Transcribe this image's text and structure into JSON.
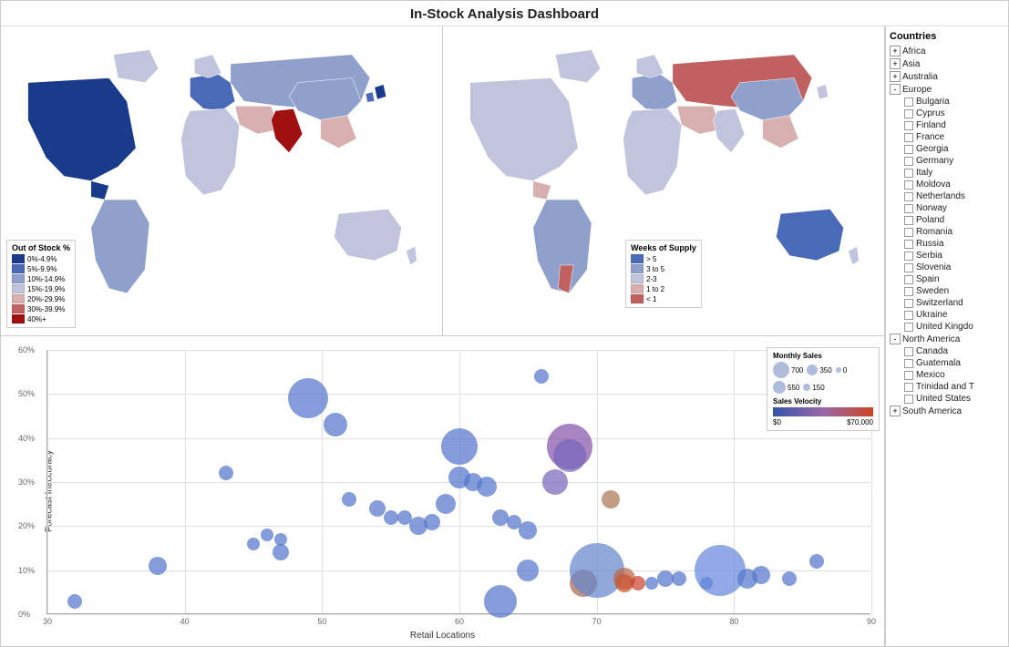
{
  "title": "In-Stock Analysis Dashboard",
  "maps": {
    "left_legend_title": "Out of Stock %",
    "left_legend_items": [
      {
        "label": "0%-4.9%",
        "color": "#1a3a8c"
      },
      {
        "label": "5%-9.9%",
        "color": "#4a6ab8"
      },
      {
        "label": "10%-14.9%",
        "color": "#8fa0cc"
      },
      {
        "label": "15%-19.9%",
        "color": "#c0c4dd"
      },
      {
        "label": "20%-29.9%",
        "color": "#d9b0b0"
      },
      {
        "label": "30%-39.9%",
        "color": "#c06060"
      },
      {
        "label": "40%+",
        "color": "#a01010"
      }
    ],
    "right_legend_title": "Weeks of Supply",
    "right_legend_items": [
      {
        "label": "> 5",
        "color": "#4a6ab8"
      },
      {
        "label": "3 to 5",
        "color": "#8fa0cc"
      },
      {
        "label": "2-3",
        "color": "#c0c4dd"
      },
      {
        "label": "1 to 2",
        "color": "#d9b0b0"
      },
      {
        "label": "< 1",
        "color": "#c06060"
      }
    ]
  },
  "scatter": {
    "title_y": "Forecast Inaccuracy",
    "title_x": "Retail Locations",
    "y_labels": [
      "0%",
      "10%",
      "20%",
      "30%",
      "40%",
      "50%",
      "60%"
    ],
    "x_labels": [
      "30",
      "40",
      "50",
      "60",
      "70",
      "80",
      "90"
    ],
    "legend_title_size": "Monthly Sales",
    "legend_sizes": [
      "700",
      "350",
      "0",
      "550",
      "150"
    ],
    "legend_gradient_title": "Sales Velocity",
    "legend_gradient_min": "$0",
    "legend_gradient_max": "$70,000",
    "bubbles": [
      {
        "x": 32,
        "y": 3,
        "r": 8,
        "color": "#5577cc"
      },
      {
        "x": 38,
        "y": 11,
        "r": 10,
        "color": "#5577cc"
      },
      {
        "x": 43,
        "y": 32,
        "r": 8,
        "color": "#5577cc"
      },
      {
        "x": 45,
        "y": 16,
        "r": 7,
        "color": "#5577cc"
      },
      {
        "x": 46,
        "y": 18,
        "r": 7,
        "color": "#5577cc"
      },
      {
        "x": 47,
        "y": 14,
        "r": 9,
        "color": "#5577cc"
      },
      {
        "x": 47,
        "y": 17,
        "r": 7,
        "color": "#5577cc"
      },
      {
        "x": 49,
        "y": 49,
        "r": 22,
        "color": "#5577cc"
      },
      {
        "x": 51,
        "y": 43,
        "r": 13,
        "color": "#5577cc"
      },
      {
        "x": 52,
        "y": 26,
        "r": 8,
        "color": "#5577cc"
      },
      {
        "x": 54,
        "y": 24,
        "r": 9,
        "color": "#5577cc"
      },
      {
        "x": 55,
        "y": 22,
        "r": 8,
        "color": "#5577cc"
      },
      {
        "x": 56,
        "y": 22,
        "r": 8,
        "color": "#5577cc"
      },
      {
        "x": 57,
        "y": 20,
        "r": 10,
        "color": "#5577cc"
      },
      {
        "x": 58,
        "y": 21,
        "r": 9,
        "color": "#5577cc"
      },
      {
        "x": 59,
        "y": 25,
        "r": 11,
        "color": "#5577cc"
      },
      {
        "x": 60,
        "y": 38,
        "r": 20,
        "color": "#5577cc"
      },
      {
        "x": 60,
        "y": 31,
        "r": 12,
        "color": "#5577cc"
      },
      {
        "x": 61,
        "y": 30,
        "r": 10,
        "color": "#5577cc"
      },
      {
        "x": 62,
        "y": 29,
        "r": 11,
        "color": "#5577cc"
      },
      {
        "x": 63,
        "y": 22,
        "r": 9,
        "color": "#5577cc"
      },
      {
        "x": 63,
        "y": 3,
        "r": 18,
        "color": "#5577cc"
      },
      {
        "x": 64,
        "y": 21,
        "r": 8,
        "color": "#5577cc"
      },
      {
        "x": 65,
        "y": 19,
        "r": 10,
        "color": "#5577cc"
      },
      {
        "x": 65,
        "y": 10,
        "r": 12,
        "color": "#5577cc"
      },
      {
        "x": 66,
        "y": 54,
        "r": 8,
        "color": "#5577cc"
      },
      {
        "x": 67,
        "y": 30,
        "r": 14,
        "color": "#7766bb"
      },
      {
        "x": 68,
        "y": 38,
        "r": 25,
        "color": "#8855aa"
      },
      {
        "x": 68,
        "y": 36,
        "r": 18,
        "color": "#7766bb"
      },
      {
        "x": 69,
        "y": 7,
        "r": 15,
        "color": "#aa6655"
      },
      {
        "x": 70,
        "y": 10,
        "r": 30,
        "color": "#6688cc"
      },
      {
        "x": 71,
        "y": 26,
        "r": 10,
        "color": "#aa7755"
      },
      {
        "x": 72,
        "y": 8,
        "r": 12,
        "color": "#bb6644"
      },
      {
        "x": 72,
        "y": 7,
        "r": 10,
        "color": "#cc5533"
      },
      {
        "x": 73,
        "y": 7,
        "r": 8,
        "color": "#cc4433"
      },
      {
        "x": 74,
        "y": 7,
        "r": 7,
        "color": "#5577cc"
      },
      {
        "x": 75,
        "y": 8,
        "r": 9,
        "color": "#5577cc"
      },
      {
        "x": 76,
        "y": 8,
        "r": 8,
        "color": "#5577cc"
      },
      {
        "x": 78,
        "y": 7,
        "r": 7,
        "color": "#5577cc"
      },
      {
        "x": 79,
        "y": 10,
        "r": 28,
        "color": "#6688dd"
      },
      {
        "x": 81,
        "y": 8,
        "r": 11,
        "color": "#5577cc"
      },
      {
        "x": 82,
        "y": 9,
        "r": 10,
        "color": "#5577cc"
      },
      {
        "x": 84,
        "y": 8,
        "r": 8,
        "color": "#5577cc"
      },
      {
        "x": 86,
        "y": 12,
        "r": 8,
        "color": "#5577cc"
      }
    ]
  },
  "sidebar": {
    "title": "Countries",
    "groups": [
      {
        "label": "Africa",
        "expanded": false,
        "children": []
      },
      {
        "label": "Asia",
        "expanded": false,
        "children": []
      },
      {
        "label": "Australia",
        "expanded": false,
        "children": []
      },
      {
        "label": "Europe",
        "expanded": true,
        "children": [
          "Bulgaria",
          "Cyprus",
          "Finland",
          "France",
          "Georgia",
          "Germany",
          "Italy",
          "Moldova",
          "Netherlands",
          "Norway",
          "Poland",
          "Romania",
          "Russia",
          "Serbia",
          "Slovenia",
          "Spain",
          "Sweden",
          "Switzerland",
          "Ukraine",
          "United Kingdo"
        ]
      },
      {
        "label": "North America",
        "expanded": true,
        "children": [
          "Canada",
          "Guatemala",
          "Mexico",
          "Trinidad and T",
          "United States"
        ]
      },
      {
        "label": "South America",
        "expanded": false,
        "children": []
      }
    ]
  }
}
